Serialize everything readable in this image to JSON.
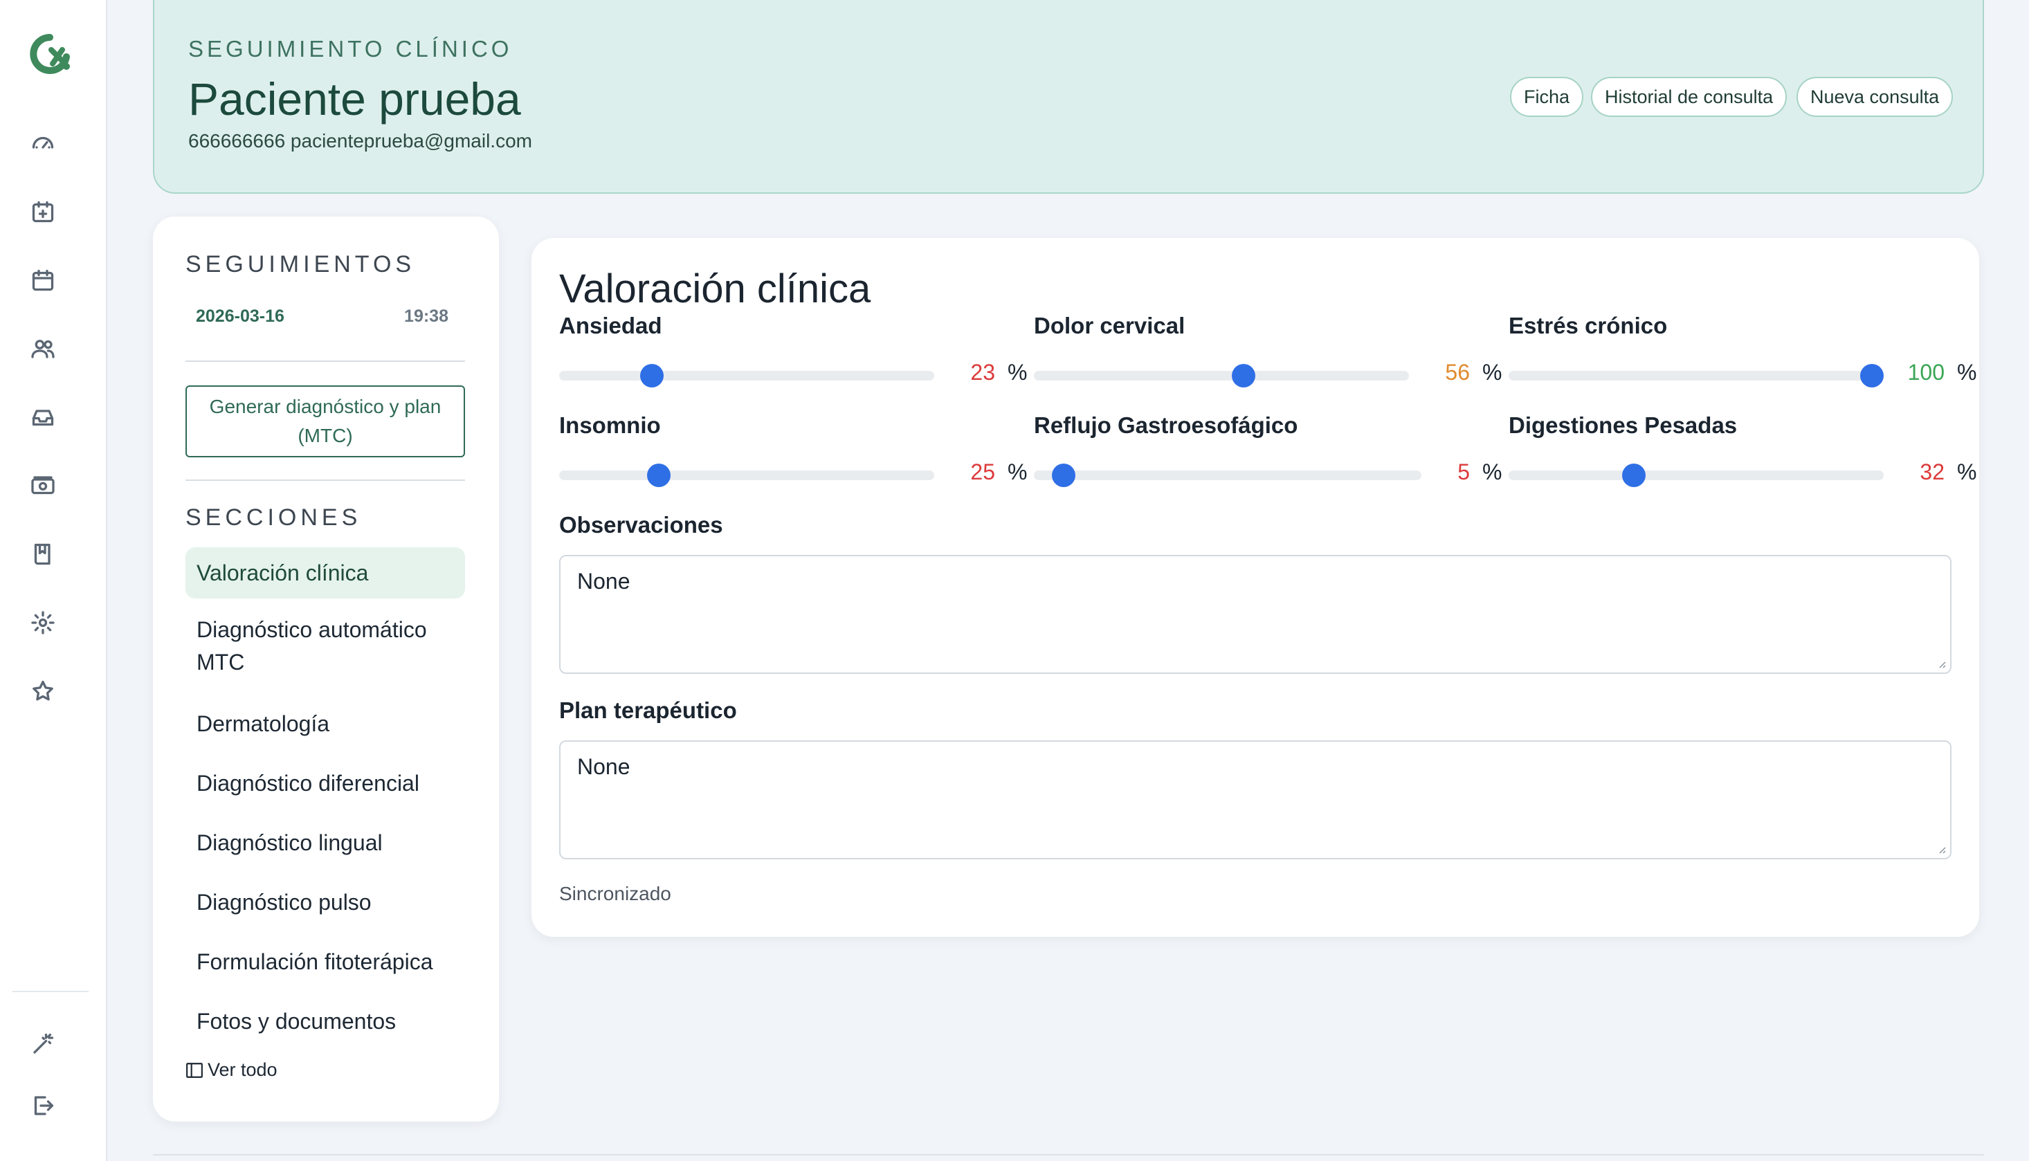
{
  "rail": {
    "items": [
      {
        "icon": "dashboard-icon"
      },
      {
        "icon": "calendar-add-icon"
      },
      {
        "icon": "calendar-icon"
      },
      {
        "icon": "users-icon"
      },
      {
        "icon": "inbox-icon"
      },
      {
        "icon": "cash-icon"
      },
      {
        "icon": "book-icon"
      },
      {
        "icon": "gear-icon"
      },
      {
        "icon": "star-icon"
      }
    ],
    "bottom": [
      {
        "icon": "magic-wand-icon"
      },
      {
        "icon": "logout-icon"
      }
    ]
  },
  "header": {
    "eyebrow": "SEGUIMIENTO CLÍNICO",
    "patient_name": "Paciente prueba",
    "contact": "666666666 pacienteprueba@gmail.com",
    "buttons": [
      "Ficha",
      "Historial de consulta",
      "Nueva consulta"
    ]
  },
  "sidebar": {
    "title": "SEGUIMIENTOS",
    "entry": {
      "date": "2026-03-16",
      "time": "19:38"
    },
    "generate_button": "Generar diagnóstico y plan (MTC)",
    "sections_title": "SECCIONES",
    "sections": [
      "Valoración clínica",
      "Diagnóstico automático MTC",
      "Dermatología",
      "Diagnóstico diferencial",
      "Diagnóstico lingual",
      "Diagnóstico pulso",
      "Formulación fitoterápica",
      "Fotos y documentos"
    ],
    "active_section": "Valoración clínica",
    "view_all": "Ver todo"
  },
  "main": {
    "title": "Valoración clínica",
    "sliders": [
      {
        "label": "Ansiedad",
        "value": "23",
        "unit": "%",
        "color": "#dc3b3b"
      },
      {
        "label": "Dolor cervical",
        "value": "56",
        "unit": "%",
        "color": "#e08a2e"
      },
      {
        "label": "Estrés crónico",
        "value": "100",
        "unit": "%",
        "color": "#3aa655"
      },
      {
        "label": "Insomnio",
        "value": "25",
        "unit": "%",
        "color": "#dc3b3b"
      },
      {
        "label": "Reflujo Gastroesofágico",
        "value": "5",
        "unit": "%",
        "color": "#dc3b3b"
      },
      {
        "label": "Digestiones Pesadas",
        "value": "32",
        "unit": "%",
        "color": "#dc3b3b"
      }
    ],
    "observations_label": "Observaciones",
    "observations_value": "None",
    "plan_label": "Plan terapéutico",
    "plan_value": "None",
    "status": "Sincronizado"
  },
  "colors": {
    "accent": "#2f6a55",
    "slider_thumb": "#2f6fe6",
    "header_bg": "#ddefec"
  }
}
